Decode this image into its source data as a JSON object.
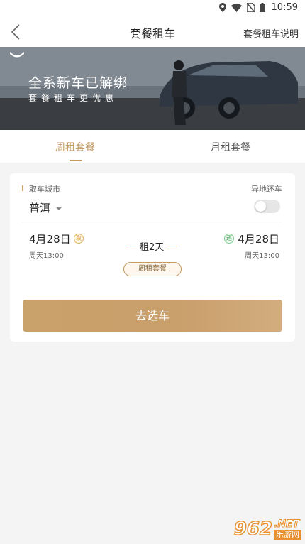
{
  "status_bar": {
    "time": "10:59"
  },
  "nav": {
    "title": "套餐租车",
    "right_link": "套餐租车说明"
  },
  "banner": {
    "headline": "全系新车已解绑",
    "subline": "套餐租车更优惠"
  },
  "tabs": [
    {
      "label": "周租套餐",
      "active": true
    },
    {
      "label": "月租套餐",
      "active": false
    }
  ],
  "form": {
    "city_label": "取车城市",
    "city_value": "普洱",
    "diff_return_label": "异地还车",
    "diff_return_on": false,
    "pickup": {
      "date": "4月28日",
      "badge": "取",
      "time": "周天13:00"
    },
    "return": {
      "date": "4月28日",
      "badge": "还",
      "time": "周天13:00"
    },
    "duration": "租2天",
    "package_tag": "周租套餐",
    "submit_label": "去选车"
  },
  "watermark": {
    "num": "962",
    "suffix": ".NET",
    "cn": "乐游网"
  },
  "colors": {
    "accent": "#c29a62",
    "button": "#c9a16a",
    "background": "#f4f4f4"
  }
}
